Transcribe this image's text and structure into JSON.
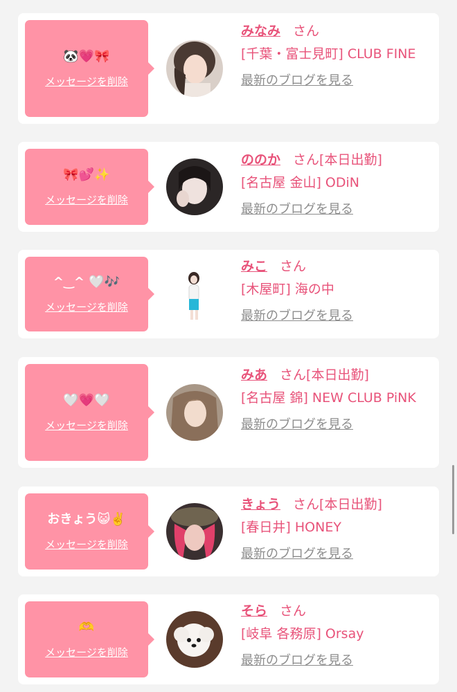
{
  "accent_color": "#e8537a",
  "bubble_color": "#ff93a6",
  "cards": [
    {
      "message": "🐼💗🎀",
      "delete_label": "メッセージを削除",
      "name": "みなみ",
      "honorific": "さん",
      "status": "",
      "shop": "[千葉・富士見町] CLUB FINE",
      "blog_label": "最新のブログを見る"
    },
    {
      "message": "🎀💕✨",
      "delete_label": "メッセージを削除",
      "name": "ののか",
      "honorific": "さん",
      "status": "[本日出勤]",
      "shop": "[名古屋 金山] ODiN",
      "blog_label": "最新のブログを見る"
    },
    {
      "message": "^‿^ 🤍🎶",
      "delete_label": "メッセージを削除",
      "name": "みこ",
      "honorific": "さん",
      "status": "",
      "shop": "[木屋町] 海の中",
      "blog_label": "最新のブログを見る"
    },
    {
      "message": "🤍💗🤍",
      "delete_label": "メッセージを削除",
      "name": "みあ",
      "honorific": "さん",
      "status": "[本日出勤]",
      "shop": "[名古屋 錦] NEW CLUB PiNK",
      "blog_label": "最新のブログを見る"
    },
    {
      "message": "おきょう😺✌️",
      "delete_label": "メッセージを削除",
      "name": "きょう",
      "honorific": "さん",
      "status": "[本日出勤]",
      "shop": "[春日井] HONEY",
      "blog_label": "最新のブログを見る"
    },
    {
      "message": "🫶",
      "delete_label": "メッセージを削除",
      "name": "そら",
      "honorific": "さん",
      "status": "",
      "shop": "[岐阜 各務原] Orsay",
      "blog_label": "最新のブログを見る"
    }
  ]
}
